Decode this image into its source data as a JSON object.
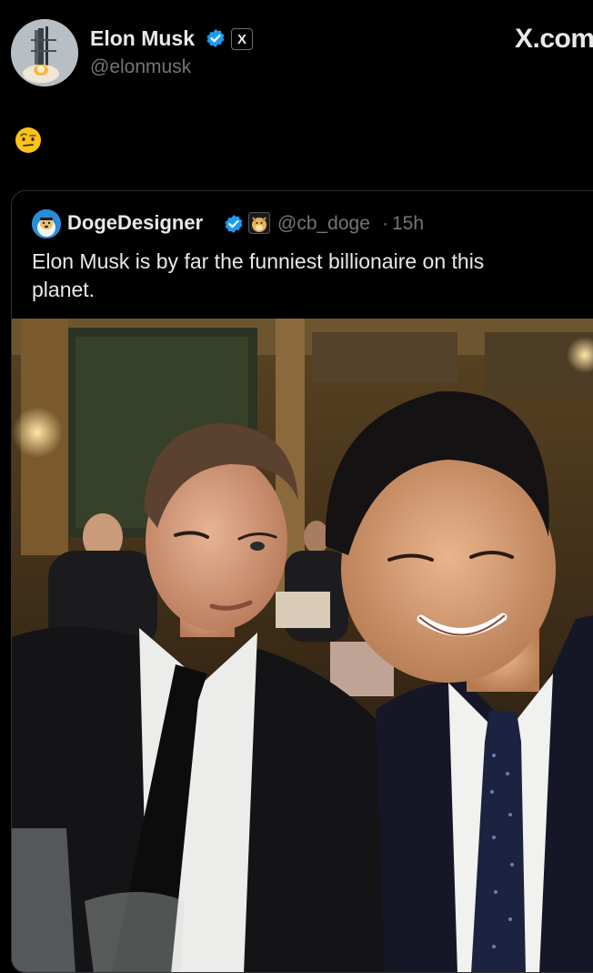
{
  "post": {
    "author": {
      "name": "Elon Musk",
      "handle": "@elonmusk",
      "avatar_icon": "rocket-launch-avatar",
      "verified": true,
      "affiliation_badge": "X"
    },
    "brand_watermark": "X.com",
    "body_emoji": "🤨",
    "quoted_post": {
      "author": {
        "name": "DogeDesigner",
        "handle": "@cb_doge",
        "separator": "·",
        "time": "15h",
        "avatar_icon": "doge-avatar",
        "verified": true,
        "affiliation_icon": "doge-badge-icon"
      },
      "text": "Elon Musk is by far the funniest billionaire on this planet.",
      "media": {
        "icon": "photo-two-men-at-banquet"
      }
    }
  },
  "colors": {
    "background": "#000000",
    "text_primary": "#e7e9ea",
    "text_secondary": "#71767b",
    "verified_blue": "#1d9bf0",
    "border": "#2f3336"
  }
}
